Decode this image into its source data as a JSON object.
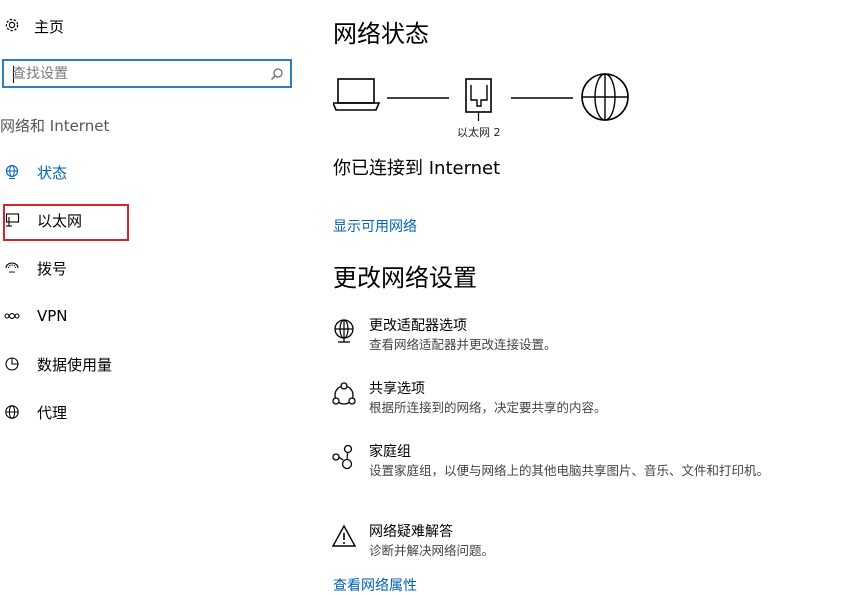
{
  "sidebar": {
    "home_label": "主页",
    "search_placeholder": "查找设置",
    "section_title": "网络和 Internet",
    "items": [
      {
        "label": "状态",
        "icon": "globe-monitor-icon",
        "active": true
      },
      {
        "label": "以太网",
        "icon": "ethernet-monitor-icon",
        "active": false
      },
      {
        "label": "拨号",
        "icon": "dialup-icon",
        "active": false
      },
      {
        "label": "VPN",
        "icon": "vpn-icon",
        "active": false
      },
      {
        "label": "数据使用量",
        "icon": "pie-chart-icon",
        "active": false
      },
      {
        "label": "代理",
        "icon": "globe-icon",
        "active": false
      }
    ]
  },
  "main": {
    "title": "网络状态",
    "ethernet_label": "以太网 2",
    "connected_text": "你已连接到 Internet",
    "show_networks_link": "显示可用网络",
    "change_title": "更改网络设置",
    "options": [
      {
        "title": "更改适配器选项",
        "desc": "查看网络适配器并更改连接设置。",
        "icon": "adapter-globe-icon"
      },
      {
        "title": "共享选项",
        "desc": "根据所连接到的网络，决定要共享的内容。",
        "icon": "sharing-icon"
      },
      {
        "title": "家庭组",
        "desc": "设置家庭组，以便与网络上的其他电脑共享图片、音乐、文件和打印机。",
        "icon": "homegroup-icon"
      },
      {
        "title": "网络疑难解答",
        "desc": "诊断并解决网络问题。",
        "icon": "warning-icon"
      }
    ],
    "bottom_link": "查看网络属性"
  },
  "colors": {
    "accent": "#0063b1",
    "highlight": "#d4252a",
    "search_border": "#2c7fb8"
  }
}
